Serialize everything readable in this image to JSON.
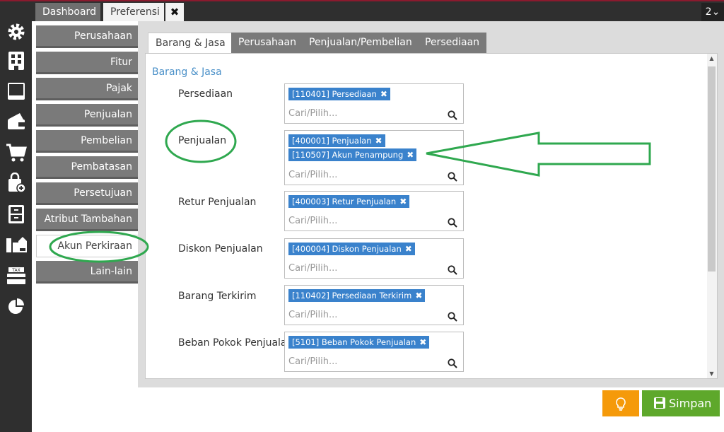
{
  "tabs_top": {
    "dashboard": "Dashboard",
    "preferensi": "Preferensi",
    "close": "✖",
    "window_count": "2⌄"
  },
  "iconbar": [
    "gear-icon",
    "building-icon",
    "book-icon",
    "wallet-icon",
    "cart-icon",
    "bag-add-icon",
    "cabinet-icon",
    "city-icon",
    "tax-icon",
    "pie-chart-icon"
  ],
  "nav": {
    "items": [
      "Perusahaan",
      "Fitur",
      "Pajak",
      "Penjualan",
      "Pembelian",
      "Pembatasan",
      "Persetujuan",
      "Atribut Tambahan",
      "Akun Perkiraan",
      "Lain-lain"
    ],
    "active_index": 8
  },
  "content_tabs": [
    "Barang & Jasa",
    "Perusahaan",
    "Penjualan/Pembelian",
    "Persediaan"
  ],
  "section_title": "Barang & Jasa",
  "search_placeholder": "Cari/Pilih...",
  "fields": [
    {
      "label": "Persediaan",
      "tags": [
        "[110401] Persediaan"
      ]
    },
    {
      "label": "Penjualan",
      "tags": [
        "[400001] Penjualan",
        "[110507] Akun Penampung"
      ]
    },
    {
      "label": "Retur Penjualan",
      "tags": [
        "[400003] Retur Penjualan"
      ]
    },
    {
      "label": "Diskon Penjualan",
      "tags": [
        "[400004] Diskon Penjualan"
      ]
    },
    {
      "label": "Barang Terkirim",
      "tags": [
        "[110402] Persediaan Terkirim"
      ]
    },
    {
      "label": "Beban Pokok Penjualan",
      "tags": [
        "[5101] Beban Pokok Penjualan"
      ]
    }
  ],
  "buttons": {
    "save": "Simpan"
  },
  "colors": {
    "accent_blue": "#3a82cc",
    "save_green": "#5ea82b",
    "hint_orange": "#f59a0a",
    "annotation_green": "#2fa84f",
    "sidebar_dark": "#2f2f2f",
    "nav_gray": "#7a7a7a"
  }
}
